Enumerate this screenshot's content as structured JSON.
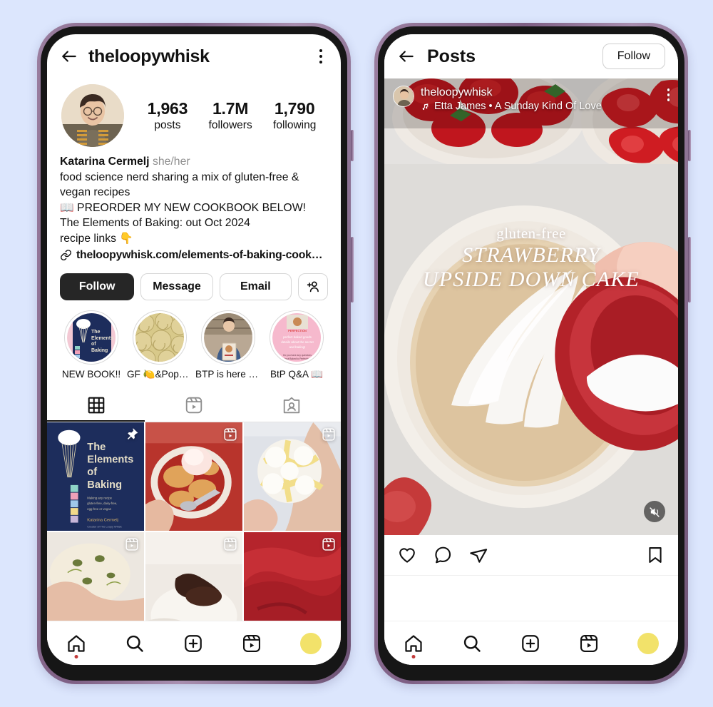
{
  "theme": {
    "background": "#dce6fd",
    "frame_outer": "#8e6f95",
    "frame_inner": "#161616",
    "accent_dark": "#262626",
    "muted_text": "#8e8e8e",
    "story_avatar": "#f2e26a",
    "notification_dot": "#c23a3a"
  },
  "profile_screen": {
    "header": {
      "back_icon": "arrow-left-icon",
      "username": "theloopywhisk",
      "menu_icon": "kebab-menu-icon"
    },
    "avatar_alt": "profile-photo",
    "stats": [
      {
        "number": "1,963",
        "label": "posts"
      },
      {
        "number": "1.7M",
        "label": "followers"
      },
      {
        "number": "1,790",
        "label": "following"
      }
    ],
    "bio": {
      "name": "Katarina Cermelj",
      "pronouns": "she/her",
      "lines": [
        "food science nerd sharing a mix of gluten-free &",
        "vegan recipes",
        "📖 PREORDER MY NEW COOKBOOK BELOW!",
        "The Elements of Baking: out Oct 2024",
        "recipe links 👇"
      ],
      "link_icon": "link-icon",
      "link": "theloopywhisk.com/elements-of-baking-cook…"
    },
    "buttons": {
      "follow": "Follow",
      "message": "Message",
      "email": "Email",
      "add_person_icon": "add-person-icon"
    },
    "highlights": [
      {
        "label": "NEW BOOK!!",
        "cover": "elements-of-baking-cover"
      },
      {
        "label": "GF 🍋&Poppy …",
        "cover": "swirl-buns"
      },
      {
        "label": "BTP is here 🎉…",
        "cover": "author-holding-book"
      },
      {
        "label": "BtP Q&A 📖",
        "cover": "pink-qa-card"
      }
    ],
    "tabs": [
      {
        "icon": "grid-icon",
        "active": true
      },
      {
        "icon": "reels-icon",
        "active": false
      },
      {
        "icon": "tagged-icon",
        "active": false
      }
    ],
    "grid_posts": [
      {
        "kind": "image",
        "badge": "pin-icon",
        "alt": "the-elements-of-baking-book-cover"
      },
      {
        "kind": "reel",
        "badge": "reel-icon",
        "alt": "cobbler-with-ice-cream"
      },
      {
        "kind": "reel",
        "badge": "reel-icon",
        "alt": "lemon-crinkle-cookie"
      },
      {
        "kind": "reel",
        "badge": "reel-icon",
        "alt": "olive-focaccia-dough"
      },
      {
        "kind": "reel",
        "badge": "reel-icon",
        "alt": "chocolate-sauce-pour"
      },
      {
        "kind": "reel",
        "badge": "reel-icon",
        "alt": "red-velvet-batter"
      }
    ],
    "bottom_nav": [
      {
        "icon": "home-icon",
        "badge": true
      },
      {
        "icon": "search-icon",
        "badge": false
      },
      {
        "icon": "create-icon",
        "badge": false
      },
      {
        "icon": "reels-icon",
        "badge": false
      },
      {
        "icon": "profile-avatar-icon",
        "badge": false
      }
    ]
  },
  "post_screen": {
    "header": {
      "back_icon": "arrow-left-icon",
      "title": "Posts",
      "follow_button": "Follow"
    },
    "post": {
      "avatar_alt": "author-avatar",
      "username": "theloopywhisk",
      "music_icon": "music-note-icon",
      "music": "Etta James • A Sunday Kind Of Love",
      "menu_icon": "kebab-menu-icon",
      "overlay": {
        "line1": "gluten-free",
        "line2": "STRAWBERRY",
        "line3": "UPSIDE DOWN CAKE"
      },
      "mute_icon": "speaker-muted-icon",
      "media_alt": "pouring-sugar-into-cake-tin-with-strawberries"
    },
    "actions": [
      {
        "icon": "heart-icon"
      },
      {
        "icon": "comment-icon"
      },
      {
        "icon": "share-icon"
      },
      {
        "icon": "bookmark-icon"
      }
    ],
    "bottom_nav": [
      {
        "icon": "home-icon",
        "badge": true
      },
      {
        "icon": "search-icon",
        "badge": false
      },
      {
        "icon": "create-icon",
        "badge": false
      },
      {
        "icon": "reels-icon",
        "badge": false
      },
      {
        "icon": "profile-avatar-icon",
        "badge": false
      }
    ]
  }
}
